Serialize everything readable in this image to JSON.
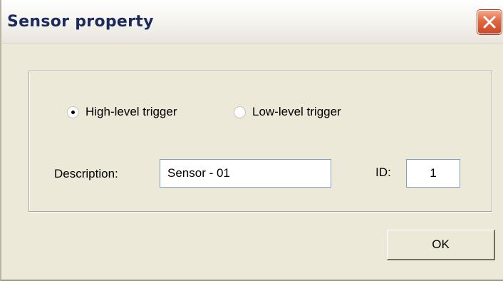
{
  "window": {
    "title": "Sensor property"
  },
  "trigger": {
    "high_label": "High-level trigger",
    "low_label": "Low-level trigger",
    "selected": "high"
  },
  "description": {
    "label": "Description:",
    "value": "Sensor - 01"
  },
  "id_field": {
    "label": "ID:",
    "value": "1"
  },
  "buttons": {
    "ok_label": "OK"
  },
  "icons": {
    "close": "close-icon"
  },
  "colors": {
    "close_button": "#e2673f",
    "title_text": "#1c2a5e",
    "dialog_background": "#ece9d8"
  }
}
